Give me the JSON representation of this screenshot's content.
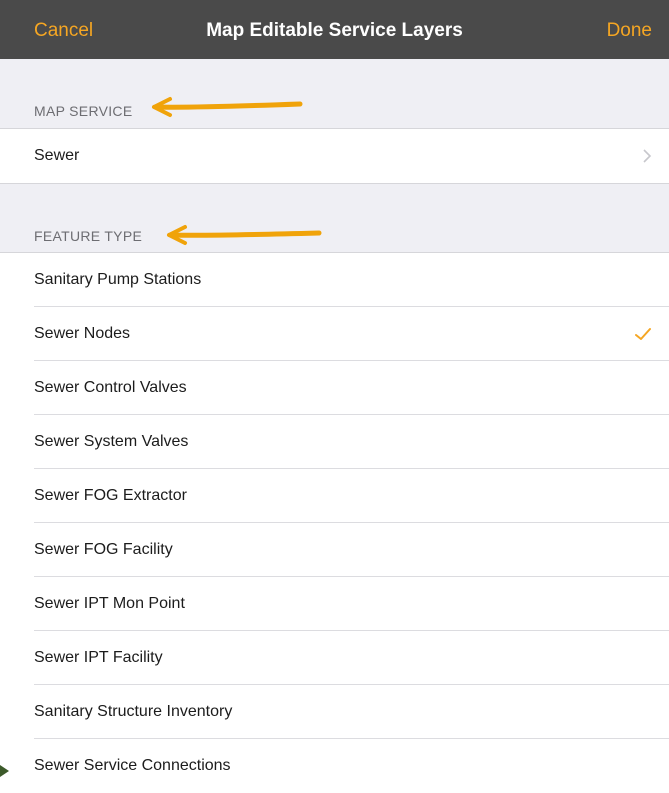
{
  "navbar": {
    "cancel_label": "Cancel",
    "title": "Map Editable Service Layers",
    "done_label": "Done"
  },
  "map_service": {
    "header": "MAP SERVICE",
    "value": "Sewer",
    "chevron_icon": "chevron-right-icon"
  },
  "feature_type": {
    "header": "FEATURE TYPE",
    "items": [
      {
        "label": "Sanitary Pump Stations",
        "checked": false
      },
      {
        "label": "Sewer Nodes",
        "checked": true
      },
      {
        "label": "Sewer Control Valves",
        "checked": false
      },
      {
        "label": "Sewer System Valves",
        "checked": false
      },
      {
        "label": "Sewer FOG Extractor",
        "checked": false
      },
      {
        "label": "Sewer FOG Facility",
        "checked": false
      },
      {
        "label": "Sewer IPT Mon Point",
        "checked": false
      },
      {
        "label": "Sewer IPT Facility",
        "checked": false
      },
      {
        "label": "Sanitary Structure Inventory",
        "checked": false
      },
      {
        "label": "Sewer Service Connections",
        "checked": false
      }
    ]
  },
  "colors": {
    "accent": "#f5a623",
    "navbar_bg": "#4a4a4a",
    "section_bg": "#efeff4",
    "annotation_arrow": "#f0a30a"
  }
}
